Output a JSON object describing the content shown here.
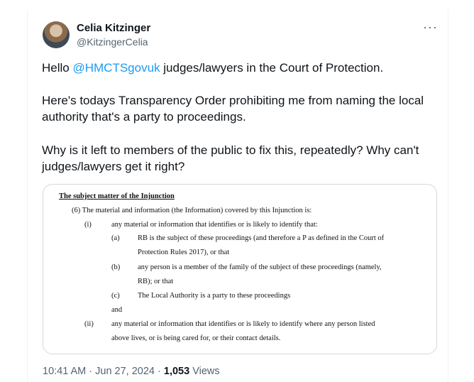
{
  "author": {
    "name": "Celia Kitzinger",
    "handle": "@KitzingerCelia"
  },
  "more_icon": "more-horizontal-icon",
  "tweet": {
    "line1_prefix": "Hello ",
    "mention": "@HMCTSgovuk",
    "line1_suffix": " judges/lawyers in the Court of Protection.",
    "para2_l1": "Here's todays Transparency Order prohibiting me from naming the local",
    "para2_l2": "authority that's a party to proceedings.",
    "para3_l1": "Why is it left to members of the public to fix this, repeatedly? Why can't",
    "para3_l2": "judges/lawyers get it right?"
  },
  "document": {
    "heading": "The subject matter of the Injunction",
    "clause6": "(6)  The material and information (the Information) covered by this Injunction is:",
    "i_num": "(i)",
    "i_text": "any material or information that identifies or is likely to identify that:",
    "a_num": "(a)",
    "a_text1": "RB is the subject of these proceedings (and therefore a P as defined in the Court of",
    "a_text2": "Protection Rules 2017), or that",
    "b_num": "(b)",
    "b_text1": "any person is a member of the family of the subject of these proceedings (namely,",
    "b_text2": "RB); or that",
    "c_num": "(c)",
    "c_text": "The Local Authority is a party to these proceedings",
    "and": "and",
    "ii_num": "(ii)",
    "ii_text1": "any material or information that identifies or is likely to identify where any person listed",
    "ii_text2": "above lives, or is being cared for, or their contact details."
  },
  "meta": {
    "time": "10:41 AM · Jun 27, 2024 · ",
    "views_count": "1,053",
    "views_label": " Views"
  }
}
